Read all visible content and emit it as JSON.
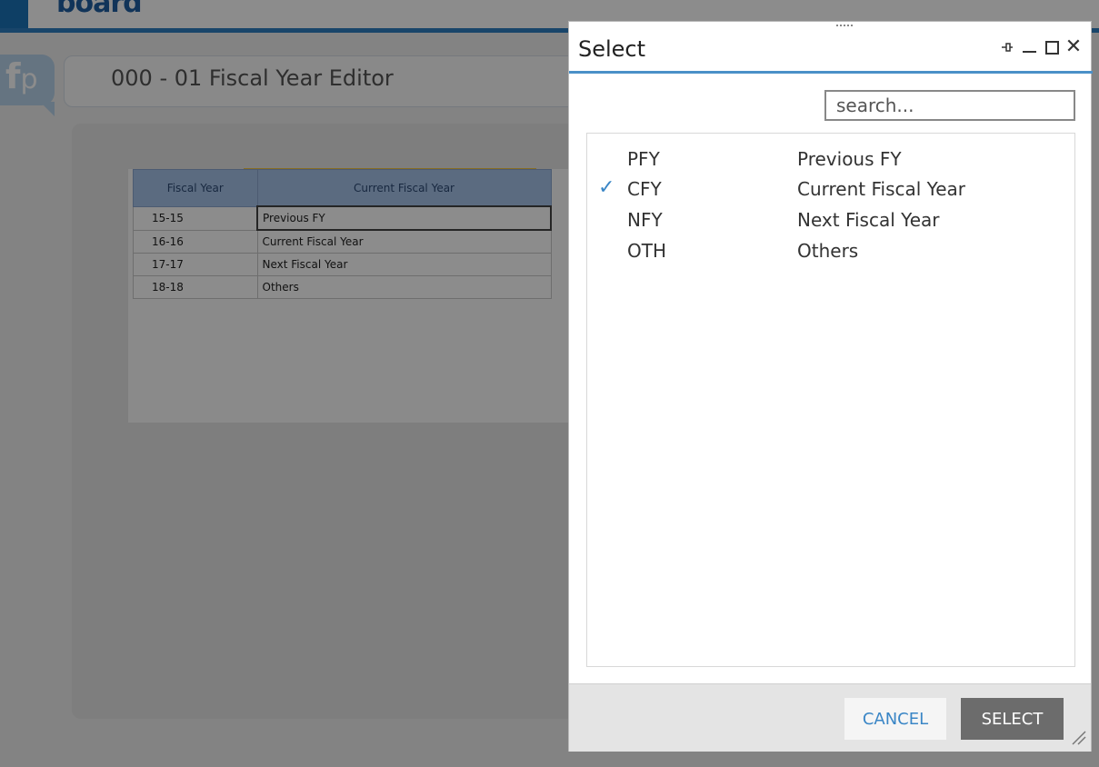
{
  "app": {
    "logo_text": "board",
    "badge_letters": "f",
    "badge_letters_2": "p",
    "page_title": "000 - 01 Fiscal Year Editor"
  },
  "grid": {
    "headers": [
      "Fiscal Year",
      "Current Fiscal Year"
    ],
    "rows": [
      {
        "year": "15-15",
        "value": "Previous FY"
      },
      {
        "year": "16-16",
        "value": "Current Fiscal Year"
      },
      {
        "year": "17-17",
        "value": "Next Fiscal Year"
      },
      {
        "year": "18-18",
        "value": "Others"
      }
    ]
  },
  "dialog": {
    "title": "Select",
    "search_placeholder": "search...",
    "items": [
      {
        "code": "PFY",
        "description": "Previous FY",
        "selected": false
      },
      {
        "code": "CFY",
        "description": "Current Fiscal Year",
        "selected": true
      },
      {
        "code": "NFY",
        "description": "Next Fiscal Year",
        "selected": false
      },
      {
        "code": "OTH",
        "description": "Others",
        "selected": false
      }
    ],
    "cancel_label": "CANCEL",
    "select_label": "SELECT"
  },
  "colors": {
    "accent": "#3a86c6",
    "header_blue": "#a6c4ea",
    "select_button": "#6c6c6c"
  }
}
